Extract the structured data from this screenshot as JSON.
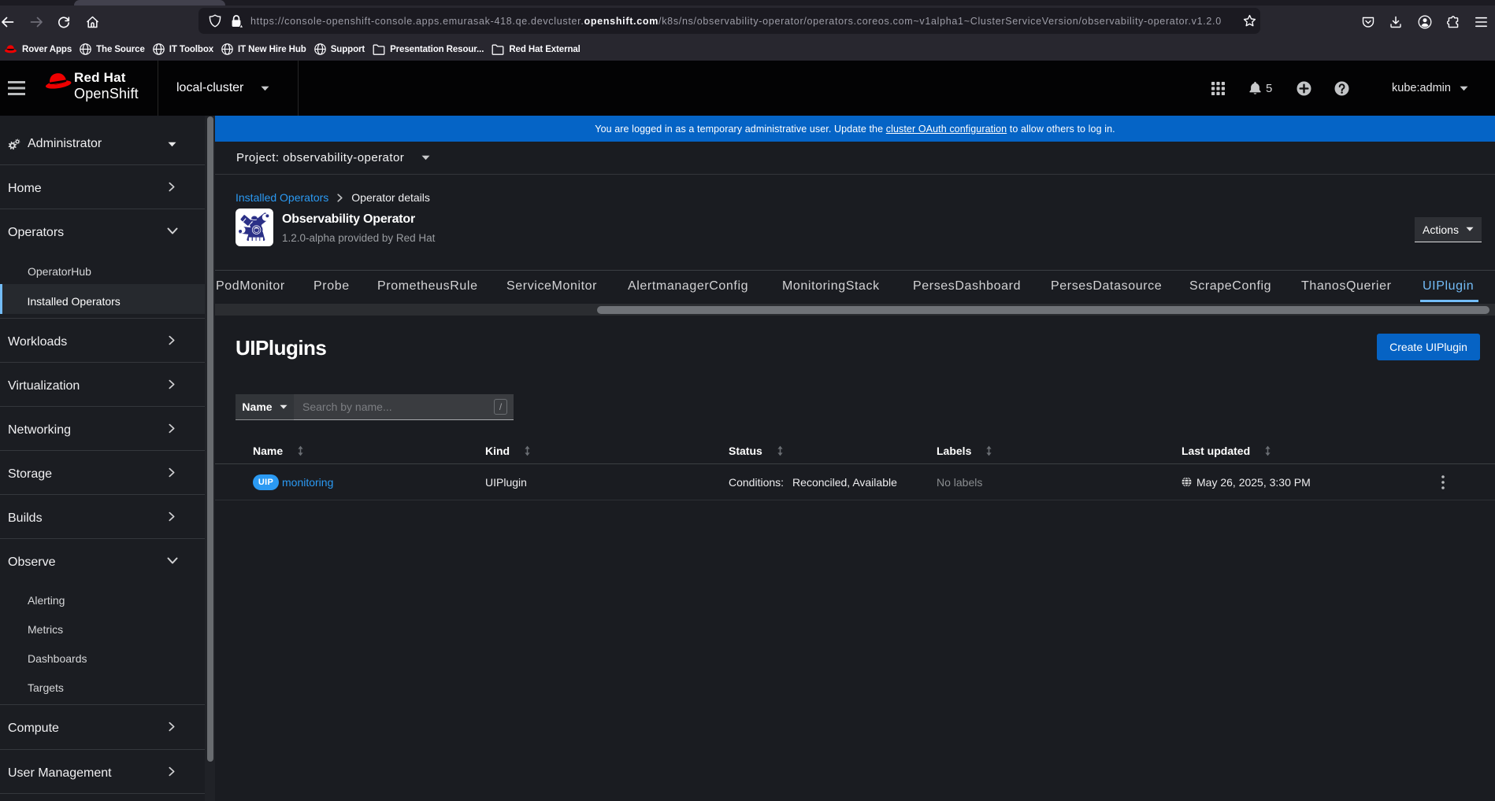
{
  "browser": {
    "url_prefix": "https://console-openshift-console.apps.emurasak-418.qe.devcluster.",
    "url_domain": "openshift.com",
    "url_path": "/k8s/ns/observability-operator/operators.coreos.com~v1alpha1~ClusterServiceVersion/observability-operator.v1.2.0",
    "bookmarks": [
      {
        "icon": "redhat-icon",
        "label": "Rover Apps"
      },
      {
        "icon": "globe-icon",
        "label": "The Source"
      },
      {
        "icon": "globe-icon",
        "label": "IT Toolbox"
      },
      {
        "icon": "globe-icon",
        "label": "IT New Hire Hub"
      },
      {
        "icon": "globe-icon",
        "label": "Support"
      },
      {
        "icon": "folder-icon",
        "label": "Presentation Resour..."
      },
      {
        "icon": "folder-icon",
        "label": "Red Hat External"
      }
    ]
  },
  "masthead": {
    "brand_line1": "Red Hat",
    "brand_line2": "OpenShift",
    "cluster_selector": "local-cluster",
    "notification_count": "5",
    "username": "kube:admin"
  },
  "alert_banner": {
    "text_before_link": "You are logged in as a temporary administrative user. Update the ",
    "link_text": "cluster OAuth configuration",
    "text_after_link": " to allow others to log in."
  },
  "project_bar": {
    "label": "Project: observability-operator"
  },
  "breadcrumb": {
    "parent": "Installed Operators",
    "current": "Operator details"
  },
  "operator": {
    "title": "Observability Operator",
    "subtitle": "1.2.0-alpha provided by Red Hat",
    "actions_label": "Actions"
  },
  "sidebar": {
    "perspective": "Administrator",
    "items": [
      {
        "label": "Home",
        "type": "expandable"
      },
      {
        "label": "Operators",
        "type": "expanded"
      },
      {
        "label": "OperatorHub",
        "type": "sub"
      },
      {
        "label": "Installed Operators",
        "type": "sub-active"
      },
      {
        "label": "Workloads",
        "type": "expandable"
      },
      {
        "label": "Virtualization",
        "type": "expandable"
      },
      {
        "label": "Networking",
        "type": "expandable"
      },
      {
        "label": "Storage",
        "type": "expandable"
      },
      {
        "label": "Builds",
        "type": "expandable"
      },
      {
        "label": "Observe",
        "type": "expanded"
      },
      {
        "label": "Alerting",
        "type": "sub"
      },
      {
        "label": "Metrics",
        "type": "sub"
      },
      {
        "label": "Dashboards",
        "type": "sub"
      },
      {
        "label": "Targets",
        "type": "sub"
      },
      {
        "label": "Compute",
        "type": "expandable"
      },
      {
        "label": "User Management",
        "type": "expandable"
      }
    ]
  },
  "tabs": [
    {
      "label": "PodMonitor"
    },
    {
      "label": "Probe"
    },
    {
      "label": "PrometheusRule"
    },
    {
      "label": "ServiceMonitor"
    },
    {
      "label": "AlertmanagerConfig"
    },
    {
      "label": "MonitoringStack"
    },
    {
      "label": "PersesDashboard"
    },
    {
      "label": "PersesDatasource"
    },
    {
      "label": "ScrapeConfig"
    },
    {
      "label": "ThanosQuerier"
    },
    {
      "label": "UIPlugin",
      "active": true
    }
  ],
  "main": {
    "title": "UIPlugins",
    "create_button": "Create UIPlugin",
    "filter_name": "Name",
    "search_placeholder": "Search by name...",
    "slash_hint": "/"
  },
  "table": {
    "columns": [
      "Name",
      "Kind",
      "Status",
      "Labels",
      "Last updated"
    ],
    "row": {
      "badge": "UIP",
      "name": "monitoring",
      "kind": "UIPlugin",
      "status_label": "Conditions:",
      "status_value": "Reconciled, Available",
      "labels": "No labels",
      "last_updated": "May 26, 2025, 3:30 PM"
    }
  },
  "colors": {
    "accent_blue": "#0663c4",
    "link_blue": "#2b9af3",
    "active_tab_blue": "#73bcf7",
    "banner_blue": "#0565c9"
  }
}
